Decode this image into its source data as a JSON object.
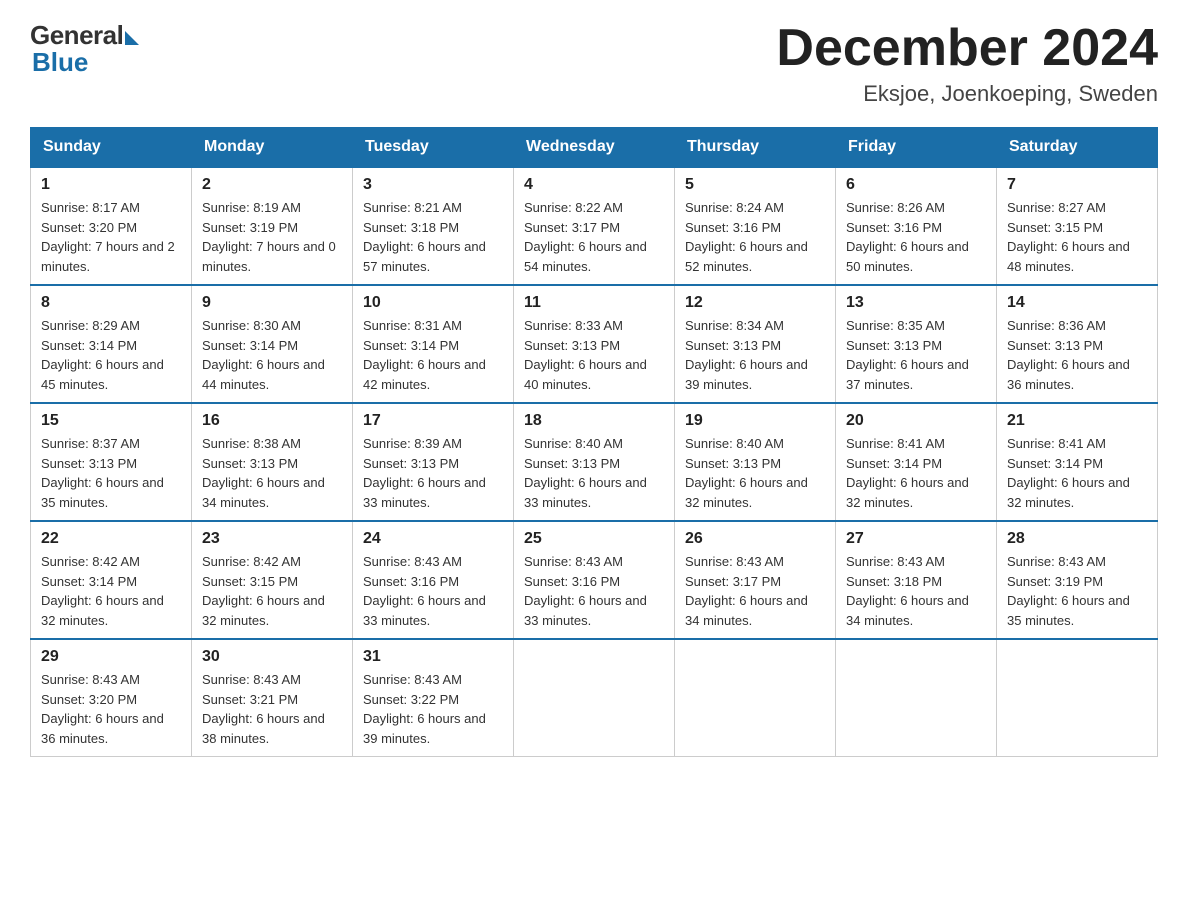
{
  "header": {
    "logo_general": "General",
    "logo_blue": "Blue",
    "title": "December 2024",
    "location": "Eksjoe, Joenkoeping, Sweden"
  },
  "calendar": {
    "days_of_week": [
      "Sunday",
      "Monday",
      "Tuesday",
      "Wednesday",
      "Thursday",
      "Friday",
      "Saturday"
    ],
    "weeks": [
      [
        {
          "day": "1",
          "sunrise": "Sunrise: 8:17 AM",
          "sunset": "Sunset: 3:20 PM",
          "daylight": "Daylight: 7 hours and 2 minutes."
        },
        {
          "day": "2",
          "sunrise": "Sunrise: 8:19 AM",
          "sunset": "Sunset: 3:19 PM",
          "daylight": "Daylight: 7 hours and 0 minutes."
        },
        {
          "day": "3",
          "sunrise": "Sunrise: 8:21 AM",
          "sunset": "Sunset: 3:18 PM",
          "daylight": "Daylight: 6 hours and 57 minutes."
        },
        {
          "day": "4",
          "sunrise": "Sunrise: 8:22 AM",
          "sunset": "Sunset: 3:17 PM",
          "daylight": "Daylight: 6 hours and 54 minutes."
        },
        {
          "day": "5",
          "sunrise": "Sunrise: 8:24 AM",
          "sunset": "Sunset: 3:16 PM",
          "daylight": "Daylight: 6 hours and 52 minutes."
        },
        {
          "day": "6",
          "sunrise": "Sunrise: 8:26 AM",
          "sunset": "Sunset: 3:16 PM",
          "daylight": "Daylight: 6 hours and 50 minutes."
        },
        {
          "day": "7",
          "sunrise": "Sunrise: 8:27 AM",
          "sunset": "Sunset: 3:15 PM",
          "daylight": "Daylight: 6 hours and 48 minutes."
        }
      ],
      [
        {
          "day": "8",
          "sunrise": "Sunrise: 8:29 AM",
          "sunset": "Sunset: 3:14 PM",
          "daylight": "Daylight: 6 hours and 45 minutes."
        },
        {
          "day": "9",
          "sunrise": "Sunrise: 8:30 AM",
          "sunset": "Sunset: 3:14 PM",
          "daylight": "Daylight: 6 hours and 44 minutes."
        },
        {
          "day": "10",
          "sunrise": "Sunrise: 8:31 AM",
          "sunset": "Sunset: 3:14 PM",
          "daylight": "Daylight: 6 hours and 42 minutes."
        },
        {
          "day": "11",
          "sunrise": "Sunrise: 8:33 AM",
          "sunset": "Sunset: 3:13 PM",
          "daylight": "Daylight: 6 hours and 40 minutes."
        },
        {
          "day": "12",
          "sunrise": "Sunrise: 8:34 AM",
          "sunset": "Sunset: 3:13 PM",
          "daylight": "Daylight: 6 hours and 39 minutes."
        },
        {
          "day": "13",
          "sunrise": "Sunrise: 8:35 AM",
          "sunset": "Sunset: 3:13 PM",
          "daylight": "Daylight: 6 hours and 37 minutes."
        },
        {
          "day": "14",
          "sunrise": "Sunrise: 8:36 AM",
          "sunset": "Sunset: 3:13 PM",
          "daylight": "Daylight: 6 hours and 36 minutes."
        }
      ],
      [
        {
          "day": "15",
          "sunrise": "Sunrise: 8:37 AM",
          "sunset": "Sunset: 3:13 PM",
          "daylight": "Daylight: 6 hours and 35 minutes."
        },
        {
          "day": "16",
          "sunrise": "Sunrise: 8:38 AM",
          "sunset": "Sunset: 3:13 PM",
          "daylight": "Daylight: 6 hours and 34 minutes."
        },
        {
          "day": "17",
          "sunrise": "Sunrise: 8:39 AM",
          "sunset": "Sunset: 3:13 PM",
          "daylight": "Daylight: 6 hours and 33 minutes."
        },
        {
          "day": "18",
          "sunrise": "Sunrise: 8:40 AM",
          "sunset": "Sunset: 3:13 PM",
          "daylight": "Daylight: 6 hours and 33 minutes."
        },
        {
          "day": "19",
          "sunrise": "Sunrise: 8:40 AM",
          "sunset": "Sunset: 3:13 PM",
          "daylight": "Daylight: 6 hours and 32 minutes."
        },
        {
          "day": "20",
          "sunrise": "Sunrise: 8:41 AM",
          "sunset": "Sunset: 3:14 PM",
          "daylight": "Daylight: 6 hours and 32 minutes."
        },
        {
          "day": "21",
          "sunrise": "Sunrise: 8:41 AM",
          "sunset": "Sunset: 3:14 PM",
          "daylight": "Daylight: 6 hours and 32 minutes."
        }
      ],
      [
        {
          "day": "22",
          "sunrise": "Sunrise: 8:42 AM",
          "sunset": "Sunset: 3:14 PM",
          "daylight": "Daylight: 6 hours and 32 minutes."
        },
        {
          "day": "23",
          "sunrise": "Sunrise: 8:42 AM",
          "sunset": "Sunset: 3:15 PM",
          "daylight": "Daylight: 6 hours and 32 minutes."
        },
        {
          "day": "24",
          "sunrise": "Sunrise: 8:43 AM",
          "sunset": "Sunset: 3:16 PM",
          "daylight": "Daylight: 6 hours and 33 minutes."
        },
        {
          "day": "25",
          "sunrise": "Sunrise: 8:43 AM",
          "sunset": "Sunset: 3:16 PM",
          "daylight": "Daylight: 6 hours and 33 minutes."
        },
        {
          "day": "26",
          "sunrise": "Sunrise: 8:43 AM",
          "sunset": "Sunset: 3:17 PM",
          "daylight": "Daylight: 6 hours and 34 minutes."
        },
        {
          "day": "27",
          "sunrise": "Sunrise: 8:43 AM",
          "sunset": "Sunset: 3:18 PM",
          "daylight": "Daylight: 6 hours and 34 minutes."
        },
        {
          "day": "28",
          "sunrise": "Sunrise: 8:43 AM",
          "sunset": "Sunset: 3:19 PM",
          "daylight": "Daylight: 6 hours and 35 minutes."
        }
      ],
      [
        {
          "day": "29",
          "sunrise": "Sunrise: 8:43 AM",
          "sunset": "Sunset: 3:20 PM",
          "daylight": "Daylight: 6 hours and 36 minutes."
        },
        {
          "day": "30",
          "sunrise": "Sunrise: 8:43 AM",
          "sunset": "Sunset: 3:21 PM",
          "daylight": "Daylight: 6 hours and 38 minutes."
        },
        {
          "day": "31",
          "sunrise": "Sunrise: 8:43 AM",
          "sunset": "Sunset: 3:22 PM",
          "daylight": "Daylight: 6 hours and 39 minutes."
        },
        null,
        null,
        null,
        null
      ]
    ]
  },
  "accent_color": "#1a6ea8"
}
